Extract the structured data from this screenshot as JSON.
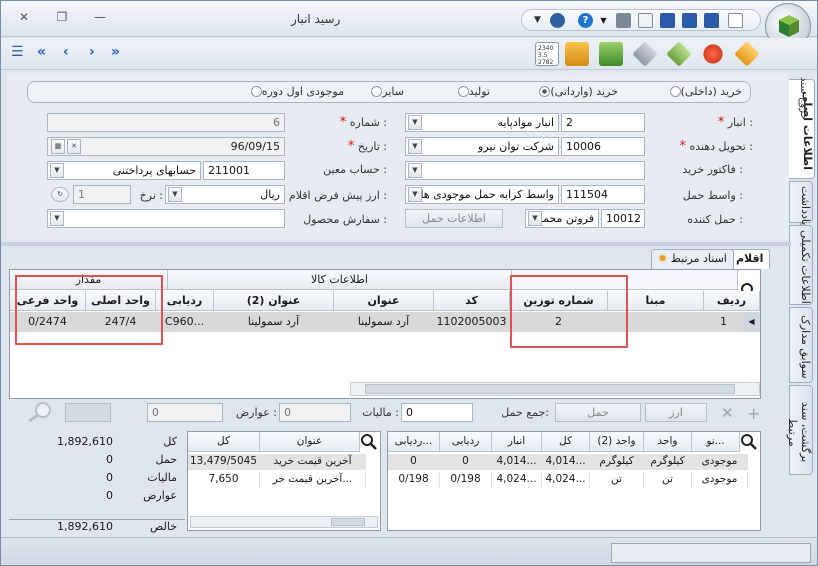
{
  "window": {
    "title": "رسید انبار",
    "close_glyph": "✕",
    "restore_glyph": "❐",
    "minimize_glyph": "—"
  },
  "toolbar": {
    "nav_first": "«",
    "nav_prev": "‹",
    "nav_next": "›",
    "nav_last": "»",
    "menu_glyph": "☰"
  },
  "side_tabs": [
    "اطلاعات اصلی",
    "خروج سند",
    "یادداشت",
    "اطلاعات تکمیلی",
    "سوابق مدارک",
    "برگشت، سند مرتبط"
  ],
  "radio_options": {
    "internal_purchase": "خرید (داخلی)",
    "import_purchase": "خرید (وارداتی)",
    "production": "تولید",
    "other": "سایر",
    "opening_stock": "موجودی اول دوره"
  },
  "form": {
    "warehouse_label": "انبار :",
    "warehouse_code": "2",
    "warehouse_name": "انبار موادپایه",
    "number_label": "شماره :",
    "number_value": "6",
    "deliverer_label": "تحویل دهنده :",
    "deliverer_code": "10006",
    "deliverer_name": "شرکت توان نیرو",
    "date_label": "تاریخ :",
    "date_value": "96/09/15",
    "invoice_label": "فاکتور خرید :",
    "invoice_value": "",
    "account_label": "حساب معین :",
    "account_code": "211001",
    "account_name": "حسابهای پرداختنی",
    "carrier_label": "واسط حمل :",
    "carrier_code": "111504",
    "carrier_name": "واسط کرایه حمل موجودی ها",
    "currency_label": "ارز پیش فرض اقلام :",
    "currency_value": "ریال",
    "rate_label": "نرخ :",
    "rate_value": "1",
    "transporter_label": "حمل کننده :",
    "transporter_code": "10012",
    "transporter_name": "فروتن محمد",
    "shipping_info_button": "اطلاعات حمل",
    "product_order_label": "سفارش محصول :",
    "product_order_value": ""
  },
  "tabs": {
    "items": "اقلام",
    "related_docs": "اسناد مرتبط"
  },
  "items_grid": {
    "group_quantity": "مقدار",
    "group_product_info": "اطلاعات کالا",
    "columns": {
      "sub_unit": "واحد فرعی",
      "main_unit": "واحد اصلی",
      "tracking": "ردیابی",
      "title2": "عنوان (2)",
      "title": "عنوان",
      "code": "کد",
      "weighing_no": "شماره توزین",
      "basis": "مبنا",
      "row": "ردیف"
    },
    "rows": [
      {
        "sub_unit": "0/2474",
        "main_unit": "247/4",
        "tracking": "C960...",
        "title2": "آرد سمولینا",
        "title": "آرد سمولینا",
        "code": "1102005003",
        "weighing_no": "2",
        "basis": "",
        "row": "1"
      }
    ]
  },
  "summary_bar": {
    "shipping_total_label": "جمع حمل:",
    "shipping_total_value": "0",
    "tax_label": "مالیات :",
    "tax_value": "0",
    "duties_label": "عوارض :",
    "duties_value": "0",
    "shipping_button": "حمل",
    "currency_button": "ارز"
  },
  "stock_grid": {
    "columns": [
      "نو...",
      "واحد",
      "واحد (2)",
      "کل",
      "انبار",
      "ردیابی",
      "ردیابی..."
    ],
    "rows": [
      [
        "موجودی",
        "کیلوگرم",
        "کیلوگرم",
        "4,014...",
        "4,014...",
        "0",
        "0"
      ],
      [
        "موجودی",
        "تن",
        "تن",
        "4,024...",
        "4,024...",
        "0/198",
        "0/198"
      ]
    ]
  },
  "price_grid": {
    "columns": [
      "عنوان",
      "کل"
    ],
    "rows": [
      [
        "آخرین قیمت خرید",
        "13,479/5045"
      ],
      [
        "آخرین قیمت خر...",
        "7,650"
      ]
    ]
  },
  "totals": {
    "total_label": "کل",
    "total_value": "1,892,610",
    "shipping_label": "حمل",
    "shipping_value": "0",
    "tax_label": "مالیات",
    "tax_value": "0",
    "duties_label": "عوارض",
    "duties_value": "0",
    "net_label": "خالص",
    "net_value": "1,892,610"
  },
  "colors": {
    "accent": "#1e5fc4",
    "highlight": "#e05252",
    "required": "#d11111"
  }
}
